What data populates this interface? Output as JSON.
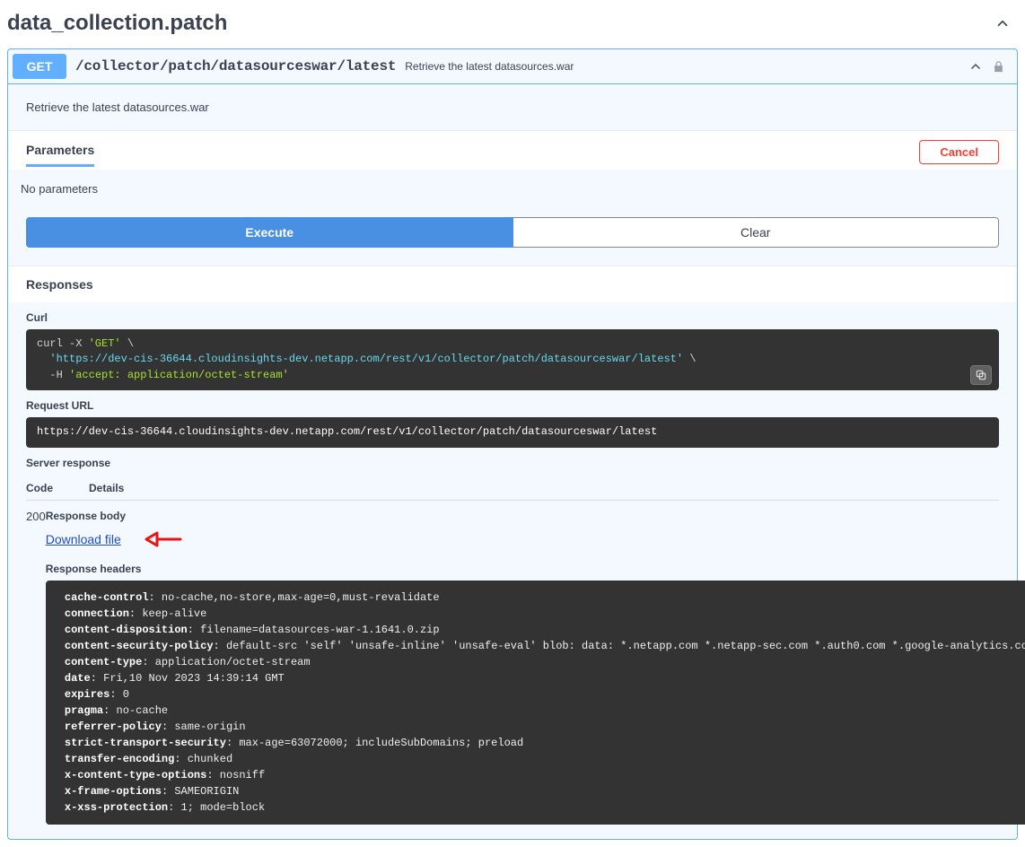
{
  "tag": {
    "name": "data_collection.patch"
  },
  "operation": {
    "method": "GET",
    "path": "/collector/patch/datasourceswar/latest",
    "summary": "Retrieve the latest datasources.war",
    "description": "Retrieve the latest datasources.war"
  },
  "sections": {
    "parameters": "Parameters",
    "responses": "Responses",
    "no_params": "No parameters",
    "cancel": "Cancel",
    "execute": "Execute",
    "clear": "Clear"
  },
  "curl": {
    "label": "Curl",
    "cmd_prefix": "curl -X ",
    "method_q": "'GET'",
    "slash": " \\",
    "indent": "  ",
    "url_q": "'https://dev-cis-36644.cloudinsights-dev.netapp.com/rest/v1/collector/patch/datasourceswar/latest'",
    "h_flag": "-H ",
    "accept_q": "'accept: application/octet-stream'"
  },
  "request_url": {
    "label": "Request URL",
    "value": "https://dev-cis-36644.cloudinsights-dev.netapp.com/rest/v1/collector/patch/datasourceswar/latest"
  },
  "server_response": {
    "label": "Server response",
    "col_code": "Code",
    "col_details": "Details",
    "status": "200",
    "body_label": "Response body",
    "download": "Download file",
    "headers_label": "Response headers",
    "headers": [
      {
        "k": "cache-control",
        "v": "no-cache,no-store,max-age=0,must-revalidate"
      },
      {
        "k": "connection",
        "v": "keep-alive"
      },
      {
        "k": "content-disposition",
        "v": "filename=datasources-war-1.1641.0.zip"
      },
      {
        "k": "content-security-policy",
        "v": "default-src 'self' 'unsafe-inline' 'unsafe-eval' blob: data: *.netapp.com *.netapp-sec.com *.auth0.com *.google-analytics.com storage.googleapis.com *.spotinst.com"
      },
      {
        "k": "content-type",
        "v": "application/octet-stream"
      },
      {
        "k": "date",
        "v": "Fri,10 Nov 2023 14:39:14 GMT"
      },
      {
        "k": "expires",
        "v": "0"
      },
      {
        "k": "pragma",
        "v": "no-cache"
      },
      {
        "k": "referrer-policy",
        "v": "same-origin"
      },
      {
        "k": "strict-transport-security",
        "v": "max-age=63072000; includeSubDomains; preload"
      },
      {
        "k": "transfer-encoding",
        "v": "chunked"
      },
      {
        "k": "x-content-type-options",
        "v": "nosniff"
      },
      {
        "k": "x-frame-options",
        "v": "SAMEORIGIN"
      },
      {
        "k": "x-xss-protection",
        "v": "1; mode=block"
      }
    ]
  }
}
